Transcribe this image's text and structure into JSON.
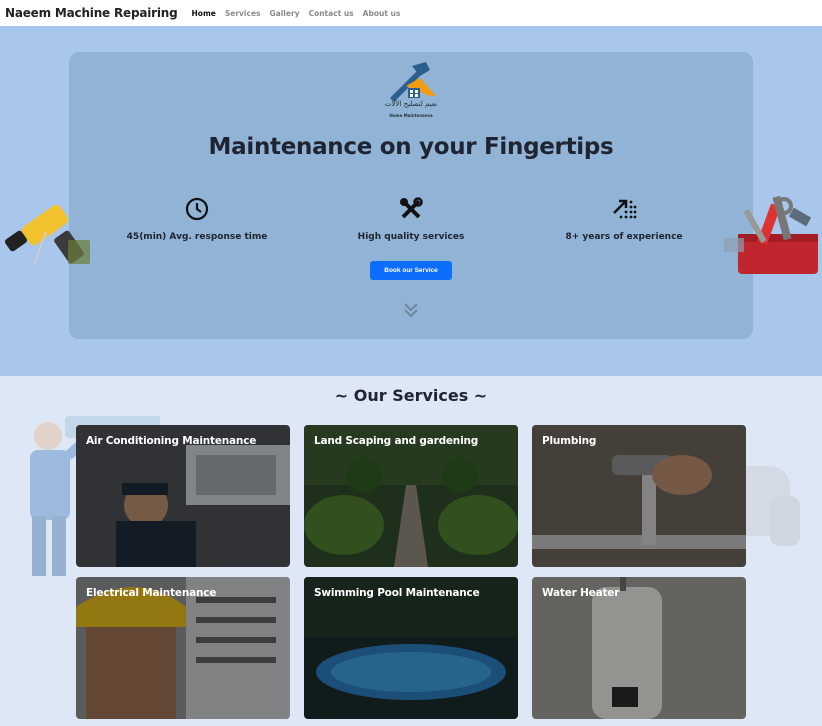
{
  "navbar": {
    "brand": "Naeem Machine Repairing",
    "links": [
      "Home",
      "Services",
      "Gallery",
      "Contact us",
      "About us"
    ]
  },
  "hero": {
    "logo_text": "نعيم لتصليح الآلات",
    "logo_subtext": "Home Maintenance",
    "title": "Maintenance on your Fingertips",
    "features": [
      {
        "icon": "clock-icon",
        "label": "45(min) Avg. response time"
      },
      {
        "icon": "tools-icon",
        "label": "High quality services"
      },
      {
        "icon": "growth-arrow-icon",
        "label": "8+ years of experience"
      }
    ],
    "cta": "Book our Service"
  },
  "services": {
    "title": "~ Our Services ~",
    "cards": [
      {
        "title": "Air Conditioning Maintenance"
      },
      {
        "title": "Land Scaping and gardening"
      },
      {
        "title": "Plumbing"
      },
      {
        "title": "Electrical Maintenance"
      },
      {
        "title": "Swimming Pool Maintenance"
      },
      {
        "title": "Water Heater"
      }
    ]
  },
  "colors": {
    "hero_bg": "#a9c7ec",
    "hero_card": "#8fb1d4",
    "services_bg": "#dde7f6",
    "cta": "#0d6efd",
    "logo_blue": "#2b5f8e",
    "logo_orange": "#f39c12"
  }
}
